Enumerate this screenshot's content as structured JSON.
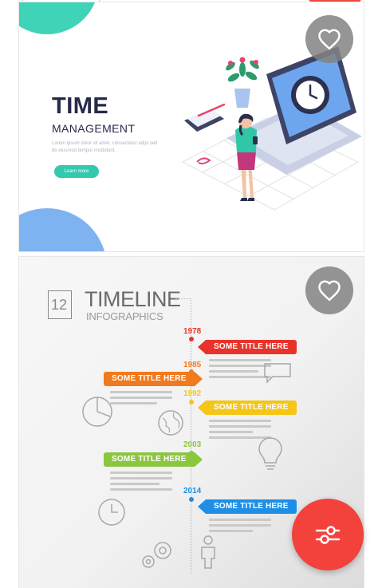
{
  "colors": {
    "accent": "#f2423b",
    "fav_bg": "#828282",
    "teal": "#3fd3b8",
    "navy": "#262a4a"
  },
  "cards": [
    {
      "title": "TIME",
      "subtitle": "MANAGEMENT",
      "body": "Lorem ipsum dolor sit amet, consectetur adipi sed do eiusmod tempor incididunt.",
      "button": "Learn more",
      "favorite_icon": "heart-outline-icon"
    },
    {
      "number": "12",
      "title": "TIMELINE",
      "subtitle": "INFOGRAPHICS",
      "favorite_icon": "heart-outline-icon",
      "events": [
        {
          "year": "1978",
          "label": "SOME TITLE HERE",
          "color": "#e8332a"
        },
        {
          "year": "1985",
          "label": "SOME TITLE HERE",
          "color": "#f07a1e"
        },
        {
          "year": "1992",
          "label": "SOME TITLE HERE",
          "color": "#f5c518"
        },
        {
          "year": "2003",
          "label": "SOME TITLE HERE",
          "color": "#8cc63f"
        },
        {
          "year": "2014",
          "label": "SOME TITLE HERE",
          "color": "#1e8fe6"
        }
      ]
    }
  ],
  "fab": {
    "icon": "filter-sliders-icon"
  }
}
